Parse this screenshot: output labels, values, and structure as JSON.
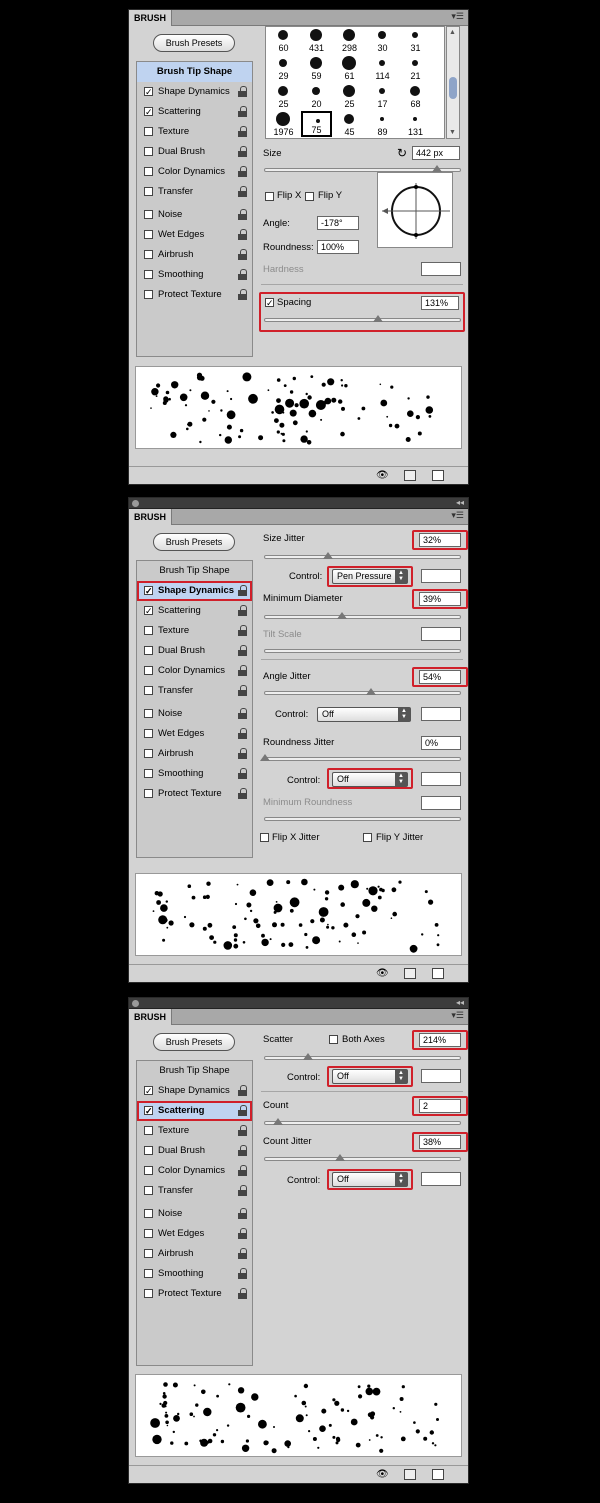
{
  "panel_tab": "BRUSH",
  "presets_button": "Brush Presets",
  "categories": {
    "tip": "Brush Tip Shape",
    "shape": "Shape Dynamics",
    "scatter": "Scattering",
    "texture": "Texture",
    "dual": "Dual Brush",
    "color": "Color Dynamics",
    "transfer": "Transfer",
    "noise": "Noise",
    "wet": "Wet Edges",
    "airbrush": "Airbrush",
    "smoothing": "Smoothing",
    "protect": "Protect Texture"
  },
  "panel1": {
    "brush_sizes": [
      "60",
      "431",
      "298",
      "30",
      "31",
      "29",
      "59",
      "61",
      "114",
      "21",
      "25",
      "20",
      "25",
      "17",
      "68",
      "1976",
      "75",
      "45",
      "89",
      "131"
    ],
    "size_label": "Size",
    "size_value": "442 px",
    "flip_x": "Flip X",
    "flip_y": "Flip Y",
    "angle_label": "Angle:",
    "angle_value": "-178°",
    "roundness_label": "Roundness:",
    "roundness_value": "100%",
    "hardness_label": "Hardness",
    "spacing_label": "Spacing",
    "spacing_value": "131%"
  },
  "panel2": {
    "size_jitter_label": "Size Jitter",
    "size_jitter_value": "32%",
    "control_label": "Control:",
    "control1": "Pen Pressure",
    "min_diameter_label": "Minimum Diameter",
    "min_diameter_value": "39%",
    "tilt_scale_label": "Tilt Scale",
    "angle_jitter_label": "Angle Jitter",
    "angle_jitter_value": "54%",
    "control2": "Off",
    "roundness_jitter_label": "Roundness Jitter",
    "roundness_jitter_value": "0%",
    "control3": "Off",
    "min_roundness_label": "Minimum Roundness",
    "flip_x_jitter": "Flip X Jitter",
    "flip_y_jitter": "Flip Y Jitter"
  },
  "panel3": {
    "scatter_label": "Scatter",
    "both_axes": "Both Axes",
    "scatter_value": "214%",
    "control_label": "Control:",
    "control1": "Off",
    "count_label": "Count",
    "count_value": "2",
    "count_jitter_label": "Count Jitter",
    "count_jitter_value": "38%",
    "control2": "Off"
  },
  "colors": {
    "highlight": "#d0202a",
    "selection": "#bfd3f0",
    "panel": "#d3d3d3"
  }
}
